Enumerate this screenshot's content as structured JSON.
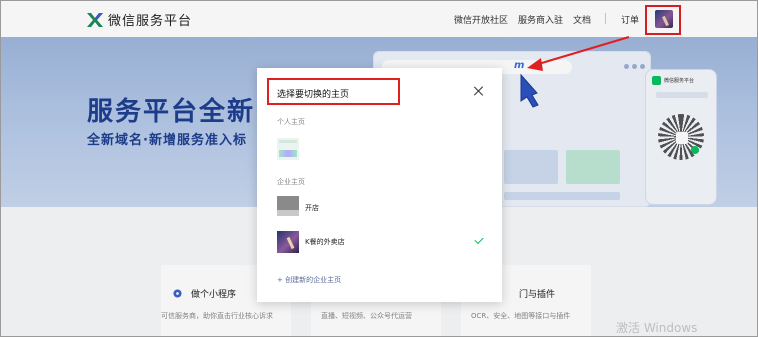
{
  "header": {
    "logo_text": "微信服务平台",
    "nav": [
      "微信开放社区",
      "服务商入驻",
      "文档"
    ],
    "order_link": "订单"
  },
  "banner": {
    "title": "服务平台全新",
    "subtitle": "全新域名·新增服务准入标",
    "url_fragment": "m",
    "phone_title": "微信服务平台"
  },
  "features": {
    "items": [
      {
        "title": "做个小程序",
        "desc": "可信服务商，助你直击行业核心诉求"
      },
      {
        "title": "",
        "desc": "直播、短视频、公众号代运营"
      },
      {
        "title": "门与插件",
        "desc": "OCR、安全、地图等接口与插件"
      }
    ],
    "watermark": "激活 Windows"
  },
  "dialog": {
    "title": "选择要切换的主页",
    "personal_label": "个人主页",
    "enterprise_label": "企业主页",
    "enterprise_items": [
      {
        "name": "开店"
      },
      {
        "name": "K餐的外卖店",
        "selected": true
      }
    ],
    "create_link": "+ 创建新的企业主页"
  },
  "colors": {
    "annotation_red": "#e02020",
    "banner_title": "#1f3f8f",
    "wechat_green": "#07c160",
    "link_blue": "#576b95"
  }
}
